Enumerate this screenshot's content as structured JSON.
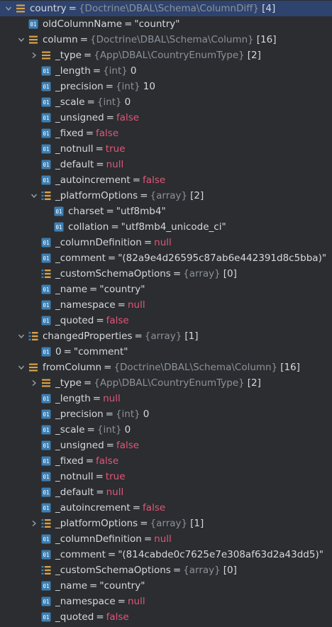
{
  "rows": [
    {
      "depth": 0,
      "arrow": "down",
      "icon": "object",
      "name": "country",
      "type": "{Doctrine\\DBAL\\Schema\\ColumnDiff}",
      "count": "[4]",
      "selected": true
    },
    {
      "depth": 1,
      "arrow": "none",
      "icon": "field",
      "name": "oldColumnName",
      "value": "\"country\"",
      "vclass": "str"
    },
    {
      "depth": 1,
      "arrow": "down",
      "icon": "object",
      "name": "column",
      "type": "{Doctrine\\DBAL\\Schema\\Column}",
      "count": "[16]"
    },
    {
      "depth": 2,
      "arrow": "right",
      "icon": "object",
      "name": "_type",
      "type": "{App\\DBAL\\CountryEnumType}",
      "count": "[2]"
    },
    {
      "depth": 2,
      "arrow": "none",
      "icon": "field",
      "name": "_length",
      "type": "{int}",
      "value": "0",
      "vclass": "num"
    },
    {
      "depth": 2,
      "arrow": "none",
      "icon": "field",
      "name": "_precision",
      "type": "{int}",
      "value": "10",
      "vclass": "num"
    },
    {
      "depth": 2,
      "arrow": "none",
      "icon": "field",
      "name": "_scale",
      "type": "{int}",
      "value": "0",
      "vclass": "num"
    },
    {
      "depth": 2,
      "arrow": "none",
      "icon": "field",
      "name": "_unsigned",
      "value": "false",
      "vclass": "kw"
    },
    {
      "depth": 2,
      "arrow": "none",
      "icon": "field",
      "name": "_fixed",
      "value": "false",
      "vclass": "kw"
    },
    {
      "depth": 2,
      "arrow": "none",
      "icon": "field",
      "name": "_notnull",
      "value": "true",
      "vclass": "kw"
    },
    {
      "depth": 2,
      "arrow": "none",
      "icon": "field",
      "name": "_default",
      "value": "null",
      "vclass": "kw"
    },
    {
      "depth": 2,
      "arrow": "none",
      "icon": "field",
      "name": "_autoincrement",
      "value": "false",
      "vclass": "kw"
    },
    {
      "depth": 2,
      "arrow": "down",
      "icon": "array",
      "name": "_platformOptions",
      "type": "{array}",
      "count": "[2]"
    },
    {
      "depth": 3,
      "arrow": "none",
      "icon": "field",
      "name": "charset",
      "value": "\"utf8mb4\"",
      "vclass": "str"
    },
    {
      "depth": 3,
      "arrow": "none",
      "icon": "field",
      "name": "collation",
      "value": "\"utf8mb4_unicode_ci\"",
      "vclass": "str"
    },
    {
      "depth": 2,
      "arrow": "none",
      "icon": "field",
      "name": "_columnDefinition",
      "value": "null",
      "vclass": "kw"
    },
    {
      "depth": 2,
      "arrow": "none",
      "icon": "field",
      "name": "_comment",
      "value": "\"(82a9e4d26595c87ab6e442391d8c5bba)\"",
      "vclass": "str"
    },
    {
      "depth": 2,
      "arrow": "none",
      "icon": "array",
      "name": "_customSchemaOptions",
      "type": "{array}",
      "count": "[0]"
    },
    {
      "depth": 2,
      "arrow": "none",
      "icon": "field",
      "name": "_name",
      "value": "\"country\"",
      "vclass": "str"
    },
    {
      "depth": 2,
      "arrow": "none",
      "icon": "field",
      "name": "_namespace",
      "value": "null",
      "vclass": "kw"
    },
    {
      "depth": 2,
      "arrow": "none",
      "icon": "field",
      "name": "_quoted",
      "value": "false",
      "vclass": "kw"
    },
    {
      "depth": 1,
      "arrow": "down",
      "icon": "array",
      "name": "changedProperties",
      "type": "{array}",
      "count": "[1]"
    },
    {
      "depth": 2,
      "arrow": "none",
      "icon": "field",
      "name": "0",
      "value": "\"comment\"",
      "vclass": "str"
    },
    {
      "depth": 1,
      "arrow": "down",
      "icon": "object",
      "name": "fromColumn",
      "type": "{Doctrine\\DBAL\\Schema\\Column}",
      "count": "[16]"
    },
    {
      "depth": 2,
      "arrow": "right",
      "icon": "object",
      "name": "_type",
      "type": "{App\\DBAL\\CountryEnumType}",
      "count": "[2]"
    },
    {
      "depth": 2,
      "arrow": "none",
      "icon": "field",
      "name": "_length",
      "value": "null",
      "vclass": "kw"
    },
    {
      "depth": 2,
      "arrow": "none",
      "icon": "field",
      "name": "_precision",
      "type": "{int}",
      "value": "0",
      "vclass": "num"
    },
    {
      "depth": 2,
      "arrow": "none",
      "icon": "field",
      "name": "_scale",
      "type": "{int}",
      "value": "0",
      "vclass": "num"
    },
    {
      "depth": 2,
      "arrow": "none",
      "icon": "field",
      "name": "_unsigned",
      "value": "false",
      "vclass": "kw"
    },
    {
      "depth": 2,
      "arrow": "none",
      "icon": "field",
      "name": "_fixed",
      "value": "false",
      "vclass": "kw"
    },
    {
      "depth": 2,
      "arrow": "none",
      "icon": "field",
      "name": "_notnull",
      "value": "true",
      "vclass": "kw"
    },
    {
      "depth": 2,
      "arrow": "none",
      "icon": "field",
      "name": "_default",
      "value": "null",
      "vclass": "kw"
    },
    {
      "depth": 2,
      "arrow": "none",
      "icon": "field",
      "name": "_autoincrement",
      "value": "false",
      "vclass": "kw"
    },
    {
      "depth": 2,
      "arrow": "right",
      "icon": "array",
      "name": "_platformOptions",
      "type": "{array}",
      "count": "[1]"
    },
    {
      "depth": 2,
      "arrow": "none",
      "icon": "field",
      "name": "_columnDefinition",
      "value": "null",
      "vclass": "kw"
    },
    {
      "depth": 2,
      "arrow": "none",
      "icon": "field",
      "name": "_comment",
      "value": "\"(814cabde0c7625e7e308af63d2a43dd5)\"",
      "vclass": "str"
    },
    {
      "depth": 2,
      "arrow": "none",
      "icon": "array",
      "name": "_customSchemaOptions",
      "type": "{array}",
      "count": "[0]"
    },
    {
      "depth": 2,
      "arrow": "none",
      "icon": "field",
      "name": "_name",
      "value": "\"country\"",
      "vclass": "str"
    },
    {
      "depth": 2,
      "arrow": "none",
      "icon": "field",
      "name": "_namespace",
      "value": "null",
      "vclass": "kw"
    },
    {
      "depth": 2,
      "arrow": "none",
      "icon": "field",
      "name": "_quoted",
      "value": "false",
      "vclass": "kw"
    }
  ],
  "colors": {
    "background": "#2b2d30",
    "selected": "#2e436e",
    "keyword": "#e0577a",
    "type": "#8c9299",
    "object_icon": "#d8a24a",
    "field_icon": "#3d7fb3"
  }
}
